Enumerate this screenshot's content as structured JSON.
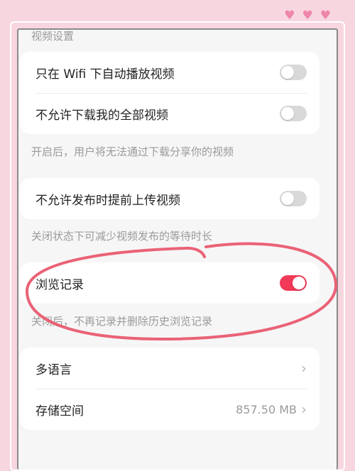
{
  "section_title": "视频设置",
  "video_group": [
    {
      "label": "只在 Wifi 下自动播放视频",
      "toggle_on": false
    },
    {
      "label": "不允许下载我的全部视频",
      "toggle_on": false
    }
  ],
  "video_hint": "开启后，用户将无法通过下载分享你的视频",
  "upload_group": [
    {
      "label": "不允许发布时提前上传视频",
      "toggle_on": false
    }
  ],
  "upload_hint": "关闭状态下可减少视频发布的等待时长",
  "history_group": [
    {
      "label": "浏览记录",
      "toggle_on": true
    }
  ],
  "history_hint": "关闭后，不再记录并删除历史浏览记录",
  "misc_group": [
    {
      "label": "多语言",
      "value": ""
    },
    {
      "label": "存储空间",
      "value": "857.50 MB"
    }
  ],
  "colors": {
    "accent": "#f03a57",
    "background": "#f7d6e0",
    "heart": "#ee85ab",
    "annotation_circle": "#e8556a"
  },
  "icons": [
    "heart-icon",
    "heart-icon",
    "heart-icon",
    "chevron-right-icon",
    "chevron-right-icon"
  ]
}
